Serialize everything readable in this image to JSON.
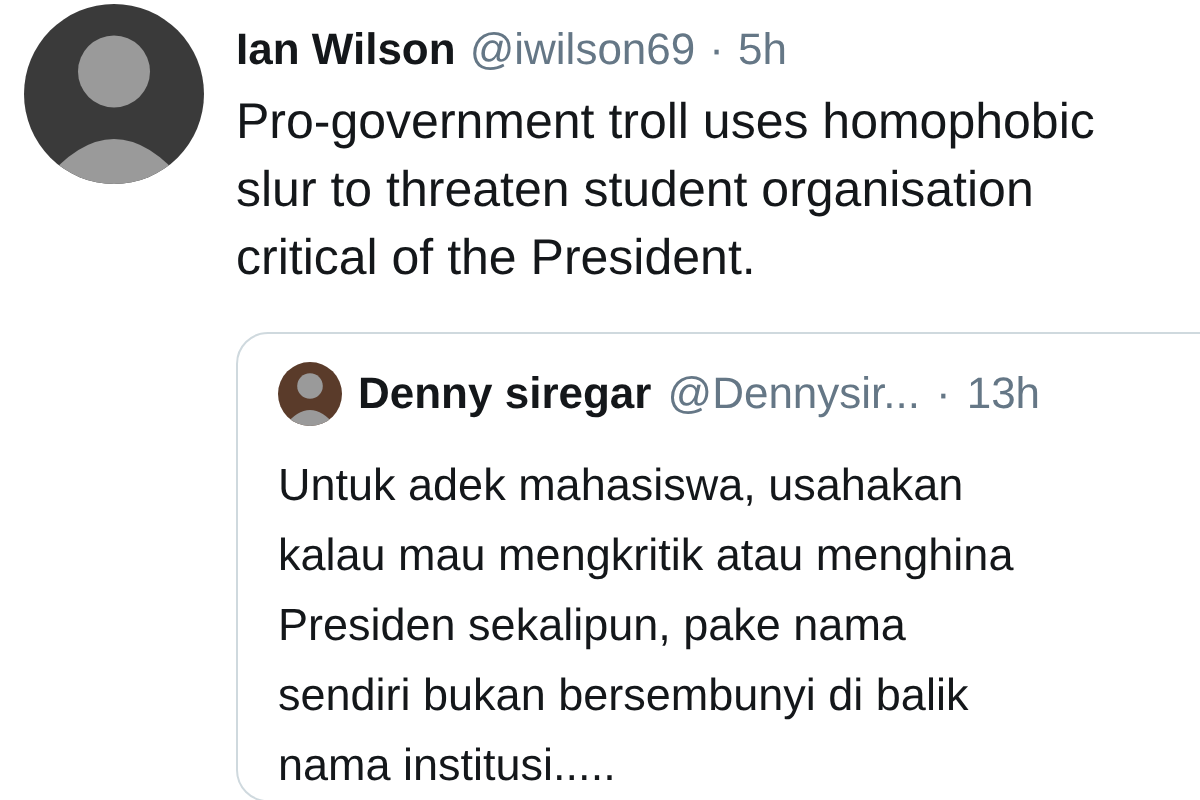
{
  "tweet": {
    "name": "Ian Wilson",
    "handle": "@iwilson69",
    "separator": "·",
    "time": "5h",
    "text": "Pro-government troll uses homophobic slur to threaten student organisation critical of the President.",
    "quote": {
      "name": "Denny siregar",
      "handle": "@Dennysir...",
      "separator": "·",
      "time": "13h",
      "text": "Untuk adek mahasiswa, usahakan kalau mau mengkritik atau menghina Presiden sekalipun, pake nama sendiri bukan bersembunyi di balik nama institusi....."
    }
  }
}
